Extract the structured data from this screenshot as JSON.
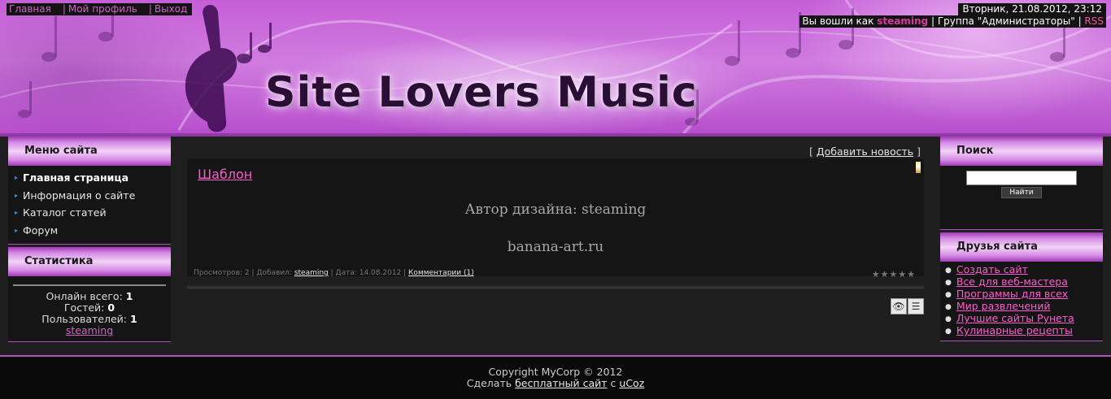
{
  "header": {
    "nav": [
      "Главная",
      "Мой профиль",
      "Выход"
    ],
    "date": "Вторник, 21.08.2012, 23:12",
    "login_prefix": "Вы вошли как",
    "username": "steaming",
    "group": "Группа \"Администраторы\"",
    "rss": "RSS",
    "site_title": "Site Lovers Music"
  },
  "left": {
    "menu_title": "Меню сайта",
    "menu_items": [
      "Главная страница",
      "Информация о сайте",
      "Каталог статей",
      "Форум"
    ],
    "stats_title": "Статистика",
    "stats": {
      "online_label": "Онлайн всего:",
      "online_value": "1",
      "guests_label": "Гостей:",
      "guests_value": "0",
      "users_label": "Пользователей:",
      "users_value": "1",
      "user_link": "steaming"
    }
  },
  "center": {
    "add_news": "Добавить новость",
    "entry": {
      "title": "Шаблон",
      "text1": "Автор дизайна: steaming",
      "text2": "banana-art.ru",
      "views": "Просмотров: 2",
      "added_by_label": "Добавил:",
      "added_by": "steaming",
      "date": "Дата: 14.08.2012",
      "comments": "Комментарии (1)",
      "stars": "★★★★★"
    }
  },
  "right": {
    "search_title": "Поиск",
    "search_button": "Найти",
    "friends_title": "Друзья сайта",
    "friends": [
      "Создать сайт",
      "Все для веб-мастера",
      "Программы для всех",
      "Мир развлечений",
      "Лучшие сайты Рунета",
      "Кулинарные рецепты"
    ]
  },
  "footer": {
    "copyright": "Copyright MyCorp © 2012",
    "make_prefix": "Сделать",
    "free_site": "бесплатный сайт",
    "with": "с",
    "ucoz": "uCoz"
  },
  "colors": {
    "accent": "#d063c8",
    "link_pink": "#ff5bd0",
    "header_purple": "#c55fd8"
  }
}
